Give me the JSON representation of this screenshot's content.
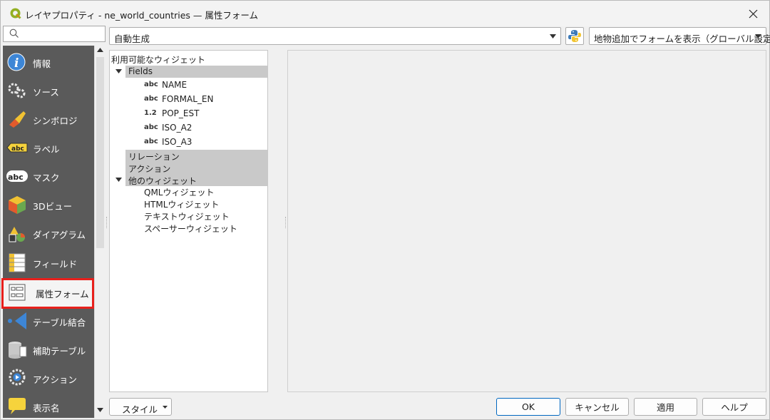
{
  "window": {
    "title": "レイヤプロパティ - ne_world_countries — 属性フォーム"
  },
  "search": {
    "placeholder": ""
  },
  "sidebar": {
    "items": [
      {
        "label": "情報",
        "icon": "info-icon"
      },
      {
        "label": "ソース",
        "icon": "source-icon"
      },
      {
        "label": "シンボロジ",
        "icon": "symbology-icon"
      },
      {
        "label": "ラベル",
        "icon": "labels-icon"
      },
      {
        "label": "マスク",
        "icon": "mask-icon"
      },
      {
        "label": "3Dビュー",
        "icon": "3d-view-icon"
      },
      {
        "label": "ダイアグラム",
        "icon": "diagram-icon"
      },
      {
        "label": "フィールド",
        "icon": "fields-icon"
      },
      {
        "label": "属性フォーム",
        "icon": "attribute-form-icon",
        "selected": true
      },
      {
        "label": "テーブル結合",
        "icon": "joins-icon"
      },
      {
        "label": "補助テーブル",
        "icon": "auxiliary-storage-icon"
      },
      {
        "label": "アクション",
        "icon": "actions-icon"
      },
      {
        "label": "表示名",
        "icon": "display-icon"
      }
    ]
  },
  "toolbar": {
    "layout_combo": "自動生成",
    "form_combo": "地物追加でフォームを表示（グローバル設定）"
  },
  "tree": {
    "header": "利用可能なウィジェット",
    "fields_group": "Fields",
    "fields": [
      {
        "type": "abc",
        "name": "NAME"
      },
      {
        "type": "abc",
        "name": "FORMAL_EN"
      },
      {
        "type": "1.2",
        "name": "POP_EST"
      },
      {
        "type": "abc",
        "name": "ISO_A2"
      },
      {
        "type": "abc",
        "name": "ISO_A3"
      }
    ],
    "relations_group": "リレーション",
    "actions_group": "アクション",
    "other_group": "他のウィジェット",
    "other_widgets": [
      "QMLウィジェット",
      "HTMLウィジェット",
      "テキストウィジェット",
      "スペーサーウィジェット"
    ]
  },
  "buttons": {
    "style": "スタイル",
    "ok": "OK",
    "cancel": "キャンセル",
    "apply": "適用",
    "help": "ヘルプ"
  },
  "colors": {
    "sidebar_bg": "#5a5a5a",
    "selection_frame": "#e8201c",
    "ok_border": "#0067c0",
    "group_bg": "#c9c9c9"
  }
}
